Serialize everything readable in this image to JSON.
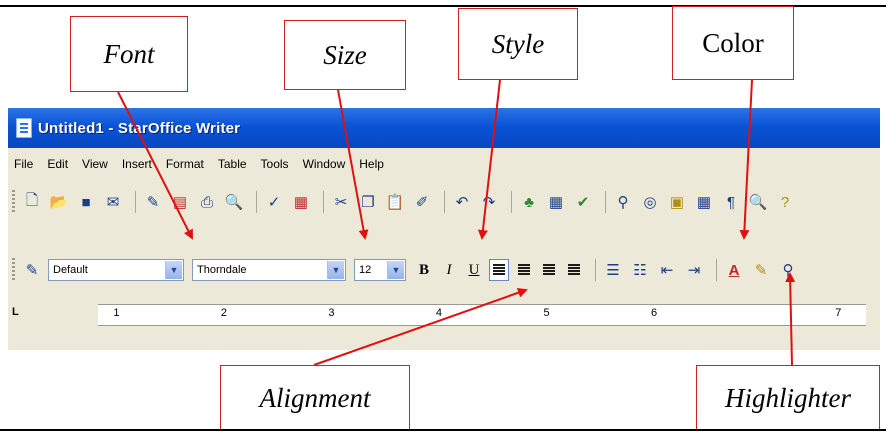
{
  "callouts": {
    "font": "Font",
    "size": "Size",
    "style": "Style",
    "color": "Color",
    "alignment": "Alignment",
    "highlighter": "Highlighter"
  },
  "window": {
    "title": "Untitled1 - StarOffice Writer",
    "menu": [
      "File",
      "Edit",
      "View",
      "Insert",
      "Format",
      "Table",
      "Tools",
      "Window",
      "Help"
    ]
  },
  "formatting": {
    "paragraph_style": "Default",
    "font_name": "Thorndale",
    "font_size": "12",
    "bold": "B",
    "italic": "I",
    "underline": "U"
  },
  "ruler": {
    "numbers": [
      "1",
      "2",
      "3",
      "4",
      "5",
      "6",
      "7"
    ]
  },
  "colors": {
    "callout_border": "#d42020",
    "arrow": "#e01010",
    "titlebar": "#0a53d6"
  },
  "icons": {
    "standard_toolbar": [
      "new-document-icon",
      "open-icon",
      "save-icon",
      "email-icon",
      "edit-file-icon",
      "export-pdf-icon",
      "print-icon",
      "page-preview-icon",
      "spellcheck-icon",
      "autospellcheck-icon",
      "cut-icon",
      "copy-icon",
      "paste-icon",
      "clone-formatting-icon",
      "undo-icon",
      "redo-icon",
      "navigator-icon",
      "table-icon",
      "show-draw-icon",
      "find-replace-icon",
      "gallery-icon",
      "datasources-icon",
      "nonprinting-chars-icon",
      "zoom-icon",
      "help-icon"
    ],
    "formatting_toolbar": [
      "styles-icon",
      "bold-icon",
      "italic-icon",
      "underline-icon",
      "align-left-icon",
      "align-center-icon",
      "align-right-icon",
      "justify-icon",
      "numbering-icon",
      "bullets-icon",
      "decrease-indent-icon",
      "increase-indent-icon",
      "font-color-icon",
      "highlighting-icon",
      "background-color-icon"
    ]
  }
}
